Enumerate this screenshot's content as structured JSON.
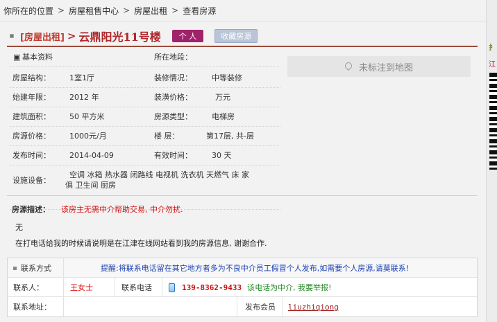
{
  "breadcrumb": {
    "prefix": "你所在的位置",
    "sep": ">",
    "items": [
      "房屋租售中心",
      "房屋出租",
      "查看房源"
    ]
  },
  "title": {
    "tag": "[房屋出租]",
    "arrow": ">",
    "name": "云鼎阳光11号楼",
    "badge": "个 人",
    "fav_button": "收藏房源"
  },
  "basic": {
    "section_label": "基本资料",
    "district_label": "所在地段：",
    "rows": [
      {
        "l1": "房屋结构：",
        "v1": "1室1厅",
        "l2": "装修情况：",
        "v2": "中等装修"
      },
      {
        "l1": "始建年限：",
        "v1": "2012 年",
        "l2": "装潢价格：",
        "v2": "万元"
      },
      {
        "l1": "建筑面积：",
        "v1": "50 平方米",
        "l2": "房源类型：",
        "v2": "电梯房"
      },
      {
        "l1": "房源价格：",
        "v1": "1000元/月",
        "l2": "楼 层：",
        "v2": "第17层, 共-层"
      },
      {
        "l1": "发布时间：",
        "v1": "2014-04-09",
        "l2": "有效时间：",
        "v2": "30 天"
      }
    ],
    "facility_label": "设施设备：",
    "facility_line1": "空调 冰箱 热水器 闭路线 电视机 洗衣机 天燃气 床 家",
    "facility_line2": "俱 卫生间 厨房"
  },
  "map_button": "未标注到地图",
  "description": {
    "label": "房源描述：",
    "note": "该房主无需中介帮助交易, 中介勿扰.",
    "body": "无",
    "tip": "在打电话给我的时候请说明是在江津在线网站看到我的房源信息, 谢谢合作."
  },
  "contact": {
    "section_label": "联系方式",
    "notice": "提醒:将联系电话留在其它地方者多为不良中介员工假冒个人发布,如需要个人房源,请莫联系!",
    "person_label": "联系人：",
    "person_value": "王女士",
    "phone_label": "联系电话",
    "phone_value": "139-8362-9433",
    "agent_report": "该电话为中介, 我要举报!",
    "address_label": "联系地址：",
    "address_value": "",
    "member_label": "发布会员",
    "member_value": "liuzhiqiong"
  },
  "colors": {
    "title_red": "#b0262b",
    "badge_purple": "#a0226a",
    "notice_blue": "#1a3fb0",
    "agent_green": "#2a8a2a"
  }
}
